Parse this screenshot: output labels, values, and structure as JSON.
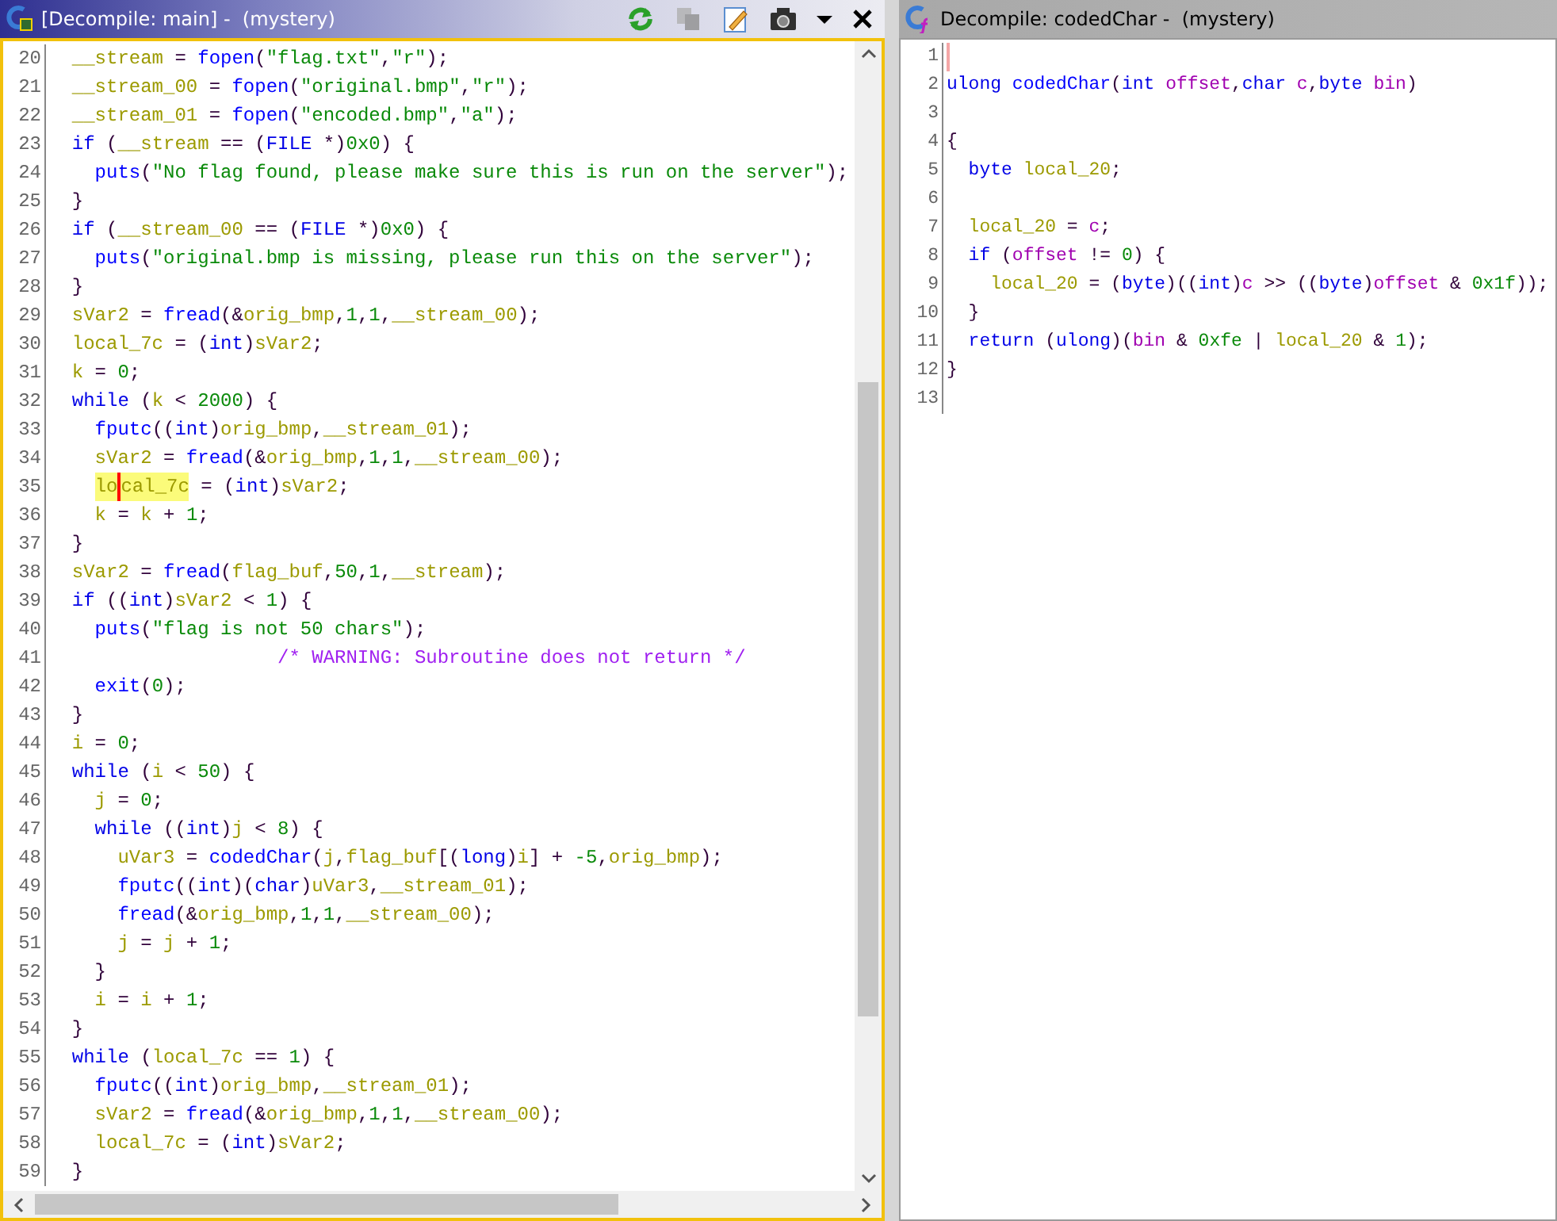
{
  "panes": [
    {
      "title": "[Decompile: main] -  (mystery)",
      "active": true,
      "toolbar": [
        {
          "kind": "refresh",
          "disabled": false
        },
        {
          "kind": "copy",
          "disabled": true
        },
        {
          "kind": "edit",
          "disabled": false
        },
        {
          "kind": "snapshot",
          "disabled": false
        },
        {
          "kind": "menu",
          "disabled": false
        },
        {
          "kind": "close",
          "disabled": false
        }
      ],
      "lines": [
        {
          "number": "20",
          "tokens": [
            {
              "text": "  __stream",
              "kind": "variable"
            },
            {
              "text": " = ",
              "kind": "punct"
            },
            {
              "text": "fopen",
              "kind": "function"
            },
            {
              "text": "(",
              "kind": "punct"
            },
            {
              "text": "\"flag.txt\"",
              "kind": "string"
            },
            {
              "text": ",",
              "kind": "punct"
            },
            {
              "text": "\"r\"",
              "kind": "string"
            },
            {
              "text": ");",
              "kind": "punct"
            }
          ]
        },
        {
          "number": "21",
          "tokens": [
            {
              "text": "  __stream_00",
              "kind": "variable"
            },
            {
              "text": " = ",
              "kind": "punct"
            },
            {
              "text": "fopen",
              "kind": "function"
            },
            {
              "text": "(",
              "kind": "punct"
            },
            {
              "text": "\"original.bmp\"",
              "kind": "string"
            },
            {
              "text": ",",
              "kind": "punct"
            },
            {
              "text": "\"r\"",
              "kind": "string"
            },
            {
              "text": ");",
              "kind": "punct"
            }
          ]
        },
        {
          "number": "22",
          "tokens": [
            {
              "text": "  __stream_01",
              "kind": "variable"
            },
            {
              "text": " = ",
              "kind": "punct"
            },
            {
              "text": "fopen",
              "kind": "function"
            },
            {
              "text": "(",
              "kind": "punct"
            },
            {
              "text": "\"encoded.bmp\"",
              "kind": "string"
            },
            {
              "text": ",",
              "kind": "punct"
            },
            {
              "text": "\"a\"",
              "kind": "string"
            },
            {
              "text": ");",
              "kind": "punct"
            }
          ]
        },
        {
          "number": "23",
          "tokens": [
            {
              "text": "  if",
              "kind": "keyword"
            },
            {
              "text": " (",
              "kind": "punct"
            },
            {
              "text": "__stream",
              "kind": "variable"
            },
            {
              "text": " == (",
              "kind": "punct"
            },
            {
              "text": "FILE",
              "kind": "keyword"
            },
            {
              "text": " *)",
              "kind": "punct"
            },
            {
              "text": "0x0",
              "kind": "string"
            },
            {
              "text": ") {",
              "kind": "punct"
            }
          ]
        },
        {
          "number": "24",
          "tokens": [
            {
              "text": "    puts",
              "kind": "function"
            },
            {
              "text": "(",
              "kind": "punct"
            },
            {
              "text": "\"No flag found, please make sure this is run on the server\"",
              "kind": "string"
            },
            {
              "text": ");",
              "kind": "punct"
            }
          ]
        },
        {
          "number": "25",
          "tokens": [
            {
              "text": "  }",
              "kind": "punct"
            }
          ]
        },
        {
          "number": "26",
          "tokens": [
            {
              "text": "  if",
              "kind": "keyword"
            },
            {
              "text": " (",
              "kind": "punct"
            },
            {
              "text": "__stream_00",
              "kind": "variable"
            },
            {
              "text": " == (",
              "kind": "punct"
            },
            {
              "text": "FILE",
              "kind": "keyword"
            },
            {
              "text": " *)",
              "kind": "punct"
            },
            {
              "text": "0x0",
              "kind": "string"
            },
            {
              "text": ") {",
              "kind": "punct"
            }
          ]
        },
        {
          "number": "27",
          "tokens": [
            {
              "text": "    puts",
              "kind": "function"
            },
            {
              "text": "(",
              "kind": "punct"
            },
            {
              "text": "\"original.bmp is missing, please run this on the server\"",
              "kind": "string"
            },
            {
              "text": ");",
              "kind": "punct"
            }
          ]
        },
        {
          "number": "28",
          "tokens": [
            {
              "text": "  }",
              "kind": "punct"
            }
          ]
        },
        {
          "number": "29",
          "tokens": [
            {
              "text": "  sVar2",
              "kind": "variable"
            },
            {
              "text": " = ",
              "kind": "punct"
            },
            {
              "text": "fread",
              "kind": "function"
            },
            {
              "text": "(&",
              "kind": "punct"
            },
            {
              "text": "orig_bmp",
              "kind": "variable"
            },
            {
              "text": ",",
              "kind": "punct"
            },
            {
              "text": "1",
              "kind": "string"
            },
            {
              "text": ",",
              "kind": "punct"
            },
            {
              "text": "1",
              "kind": "string"
            },
            {
              "text": ",",
              "kind": "punct"
            },
            {
              "text": "__stream_00",
              "kind": "variable"
            },
            {
              "text": ");",
              "kind": "punct"
            }
          ]
        },
        {
          "number": "30",
          "tokens": [
            {
              "text": "  local_7c",
              "kind": "variable"
            },
            {
              "text": " = (",
              "kind": "punct"
            },
            {
              "text": "int",
              "kind": "keyword"
            },
            {
              "text": ")",
              "kind": "punct"
            },
            {
              "text": "sVar2",
              "kind": "variable"
            },
            {
              "text": ";",
              "kind": "punct"
            }
          ]
        },
        {
          "number": "31",
          "tokens": [
            {
              "text": "  k",
              "kind": "variable"
            },
            {
              "text": " = ",
              "kind": "punct"
            },
            {
              "text": "0",
              "kind": "string"
            },
            {
              "text": ";",
              "kind": "punct"
            }
          ]
        },
        {
          "number": "32",
          "tokens": [
            {
              "text": "  while",
              "kind": "keyword"
            },
            {
              "text": " (",
              "kind": "punct"
            },
            {
              "text": "k",
              "kind": "variable"
            },
            {
              "text": " < ",
              "kind": "punct"
            },
            {
              "text": "2000",
              "kind": "string"
            },
            {
              "text": ") {",
              "kind": "punct"
            }
          ]
        },
        {
          "number": "33",
          "tokens": [
            {
              "text": "    fputc",
              "kind": "function"
            },
            {
              "text": "((",
              "kind": "punct"
            },
            {
              "text": "int",
              "kind": "keyword"
            },
            {
              "text": ")",
              "kind": "punct"
            },
            {
              "text": "orig_bmp",
              "kind": "variable"
            },
            {
              "text": ",",
              "kind": "punct"
            },
            {
              "text": "__stream_01",
              "kind": "variable"
            },
            {
              "text": ");",
              "kind": "punct"
            }
          ]
        },
        {
          "number": "34",
          "tokens": [
            {
              "text": "    sVar2",
              "kind": "variable"
            },
            {
              "text": " = ",
              "kind": "punct"
            },
            {
              "text": "fread",
              "kind": "function"
            },
            {
              "text": "(&",
              "kind": "punct"
            },
            {
              "text": "orig_bmp",
              "kind": "variable"
            },
            {
              "text": ",",
              "kind": "punct"
            },
            {
              "text": "1",
              "kind": "string"
            },
            {
              "text": ",",
              "kind": "punct"
            },
            {
              "text": "1",
              "kind": "string"
            },
            {
              "text": ",",
              "kind": "punct"
            },
            {
              "text": "__stream_00",
              "kind": "variable"
            },
            {
              "text": ");",
              "kind": "punct"
            }
          ]
        },
        {
          "number": "35",
          "tokens": [
            {
              "text": "    lo",
              "kind": "match"
            },
            {
              "kind": "caret"
            },
            {
              "text": "cal_7c",
              "kind": "match"
            },
            {
              "text": " = (",
              "kind": "punct"
            },
            {
              "text": "int",
              "kind": "keyword"
            },
            {
              "text": ")",
              "kind": "punct"
            },
            {
              "text": "sVar2",
              "kind": "variable"
            },
            {
              "text": ";",
              "kind": "punct"
            }
          ]
        },
        {
          "number": "36",
          "tokens": [
            {
              "text": "    k",
              "kind": "variable"
            },
            {
              "text": " = ",
              "kind": "punct"
            },
            {
              "text": "k",
              "kind": "variable"
            },
            {
              "text": " + ",
              "kind": "punct"
            },
            {
              "text": "1",
              "kind": "string"
            },
            {
              "text": ";",
              "kind": "punct"
            }
          ]
        },
        {
          "number": "37",
          "tokens": [
            {
              "text": "  }",
              "kind": "punct"
            }
          ]
        },
        {
          "number": "38",
          "tokens": [
            {
              "text": "  sVar2",
              "kind": "variable"
            },
            {
              "text": " = ",
              "kind": "punct"
            },
            {
              "text": "fread",
              "kind": "function"
            },
            {
              "text": "(",
              "kind": "punct"
            },
            {
              "text": "flag_buf",
              "kind": "variable"
            },
            {
              "text": ",",
              "kind": "punct"
            },
            {
              "text": "50",
              "kind": "string"
            },
            {
              "text": ",",
              "kind": "punct"
            },
            {
              "text": "1",
              "kind": "string"
            },
            {
              "text": ",",
              "kind": "punct"
            },
            {
              "text": "__stream",
              "kind": "variable"
            },
            {
              "text": ");",
              "kind": "punct"
            }
          ]
        },
        {
          "number": "39",
          "tokens": [
            {
              "text": "  if",
              "kind": "keyword"
            },
            {
              "text": " ((",
              "kind": "punct"
            },
            {
              "text": "int",
              "kind": "keyword"
            },
            {
              "text": ")",
              "kind": "punct"
            },
            {
              "text": "sVar2",
              "kind": "variable"
            },
            {
              "text": " < ",
              "kind": "punct"
            },
            {
              "text": "1",
              "kind": "string"
            },
            {
              "text": ") {",
              "kind": "punct"
            }
          ]
        },
        {
          "number": "40",
          "tokens": [
            {
              "text": "    puts",
              "kind": "function"
            },
            {
              "text": "(",
              "kind": "punct"
            },
            {
              "text": "\"flag is not 50 chars\"",
              "kind": "string"
            },
            {
              "text": ");",
              "kind": "punct"
            }
          ]
        },
        {
          "number": "41",
          "tokens": [
            {
              "text": "                    /* WARNING: Subroutine does not return */",
              "kind": "comment"
            }
          ]
        },
        {
          "number": "42",
          "tokens": [
            {
              "text": "    exit",
              "kind": "function"
            },
            {
              "text": "(",
              "kind": "punct"
            },
            {
              "text": "0",
              "kind": "string"
            },
            {
              "text": ");",
              "kind": "punct"
            }
          ]
        },
        {
          "number": "43",
          "tokens": [
            {
              "text": "  }",
              "kind": "punct"
            }
          ]
        },
        {
          "number": "44",
          "tokens": [
            {
              "text": "  i",
              "kind": "variable"
            },
            {
              "text": " = ",
              "kind": "punct"
            },
            {
              "text": "0",
              "kind": "string"
            },
            {
              "text": ";",
              "kind": "punct"
            }
          ]
        },
        {
          "number": "45",
          "tokens": [
            {
              "text": "  while",
              "kind": "keyword"
            },
            {
              "text": " (",
              "kind": "punct"
            },
            {
              "text": "i",
              "kind": "variable"
            },
            {
              "text": " < ",
              "kind": "punct"
            },
            {
              "text": "50",
              "kind": "string"
            },
            {
              "text": ") {",
              "kind": "punct"
            }
          ]
        },
        {
          "number": "46",
          "tokens": [
            {
              "text": "    j",
              "kind": "variable"
            },
            {
              "text": " = ",
              "kind": "punct"
            },
            {
              "text": "0",
              "kind": "string"
            },
            {
              "text": ";",
              "kind": "punct"
            }
          ]
        },
        {
          "number": "47",
          "tokens": [
            {
              "text": "    while",
              "kind": "keyword"
            },
            {
              "text": " ((",
              "kind": "punct"
            },
            {
              "text": "int",
              "kind": "keyword"
            },
            {
              "text": ")",
              "kind": "punct"
            },
            {
              "text": "j",
              "kind": "variable"
            },
            {
              "text": " < ",
              "kind": "punct"
            },
            {
              "text": "8",
              "kind": "string"
            },
            {
              "text": ") {",
              "kind": "punct"
            }
          ]
        },
        {
          "number": "48",
          "tokens": [
            {
              "text": "      uVar3",
              "kind": "variable"
            },
            {
              "text": " = ",
              "kind": "punct"
            },
            {
              "text": "codedChar",
              "kind": "function"
            },
            {
              "text": "(",
              "kind": "punct"
            },
            {
              "text": "j",
              "kind": "variable"
            },
            {
              "text": ",",
              "kind": "punct"
            },
            {
              "text": "flag_buf",
              "kind": "variable"
            },
            {
              "text": "[(",
              "kind": "punct"
            },
            {
              "text": "long",
              "kind": "keyword"
            },
            {
              "text": ")",
              "kind": "punct"
            },
            {
              "text": "i",
              "kind": "variable"
            },
            {
              "text": "] + ",
              "kind": "punct"
            },
            {
              "text": "-5",
              "kind": "string"
            },
            {
              "text": ",",
              "kind": "punct"
            },
            {
              "text": "orig_bmp",
              "kind": "variable"
            },
            {
              "text": ");",
              "kind": "punct"
            }
          ]
        },
        {
          "number": "49",
          "tokens": [
            {
              "text": "      fputc",
              "kind": "function"
            },
            {
              "text": "((",
              "kind": "punct"
            },
            {
              "text": "int",
              "kind": "keyword"
            },
            {
              "text": ")(",
              "kind": "punct"
            },
            {
              "text": "char",
              "kind": "keyword"
            },
            {
              "text": ")",
              "kind": "punct"
            },
            {
              "text": "uVar3",
              "kind": "variable"
            },
            {
              "text": ",",
              "kind": "punct"
            },
            {
              "text": "__stream_01",
              "kind": "variable"
            },
            {
              "text": ");",
              "kind": "punct"
            }
          ]
        },
        {
          "number": "50",
          "tokens": [
            {
              "text": "      fread",
              "kind": "function"
            },
            {
              "text": "(&",
              "kind": "punct"
            },
            {
              "text": "orig_bmp",
              "kind": "variable"
            },
            {
              "text": ",",
              "kind": "punct"
            },
            {
              "text": "1",
              "kind": "string"
            },
            {
              "text": ",",
              "kind": "punct"
            },
            {
              "text": "1",
              "kind": "string"
            },
            {
              "text": ",",
              "kind": "punct"
            },
            {
              "text": "__stream_00",
              "kind": "variable"
            },
            {
              "text": ");",
              "kind": "punct"
            }
          ]
        },
        {
          "number": "51",
          "tokens": [
            {
              "text": "      j",
              "kind": "variable"
            },
            {
              "text": " = ",
              "kind": "punct"
            },
            {
              "text": "j",
              "kind": "variable"
            },
            {
              "text": " + ",
              "kind": "punct"
            },
            {
              "text": "1",
              "kind": "string"
            },
            {
              "text": ";",
              "kind": "punct"
            }
          ]
        },
        {
          "number": "52",
          "tokens": [
            {
              "text": "    }",
              "kind": "punct"
            }
          ]
        },
        {
          "number": "53",
          "tokens": [
            {
              "text": "    i",
              "kind": "variable"
            },
            {
              "text": " = ",
              "kind": "punct"
            },
            {
              "text": "i",
              "kind": "variable"
            },
            {
              "text": " + ",
              "kind": "punct"
            },
            {
              "text": "1",
              "kind": "string"
            },
            {
              "text": ";",
              "kind": "punct"
            }
          ]
        },
        {
          "number": "54",
          "tokens": [
            {
              "text": "  }",
              "kind": "punct"
            }
          ]
        },
        {
          "number": "55",
          "tokens": [
            {
              "text": "  while",
              "kind": "keyword"
            },
            {
              "text": " (",
              "kind": "punct"
            },
            {
              "text": "local_7c",
              "kind": "variable"
            },
            {
              "text": " == ",
              "kind": "punct"
            },
            {
              "text": "1",
              "kind": "string"
            },
            {
              "text": ") {",
              "kind": "punct"
            }
          ]
        },
        {
          "number": "56",
          "tokens": [
            {
              "text": "    fputc",
              "kind": "function"
            },
            {
              "text": "((",
              "kind": "punct"
            },
            {
              "text": "int",
              "kind": "keyword"
            },
            {
              "text": ")",
              "kind": "punct"
            },
            {
              "text": "orig_bmp",
              "kind": "variable"
            },
            {
              "text": ",",
              "kind": "punct"
            },
            {
              "text": "__stream_01",
              "kind": "variable"
            },
            {
              "text": ");",
              "kind": "punct"
            }
          ]
        },
        {
          "number": "57",
          "tokens": [
            {
              "text": "    sVar2",
              "kind": "variable"
            },
            {
              "text": " = ",
              "kind": "punct"
            },
            {
              "text": "fread",
              "kind": "function"
            },
            {
              "text": "(&",
              "kind": "punct"
            },
            {
              "text": "orig_bmp",
              "kind": "variable"
            },
            {
              "text": ",",
              "kind": "punct"
            },
            {
              "text": "1",
              "kind": "string"
            },
            {
              "text": ",",
              "kind": "punct"
            },
            {
              "text": "1",
              "kind": "string"
            },
            {
              "text": ",",
              "kind": "punct"
            },
            {
              "text": "__stream_00",
              "kind": "variable"
            },
            {
              "text": ");",
              "kind": "punct"
            }
          ]
        },
        {
          "number": "58",
          "tokens": [
            {
              "text": "    local_7c",
              "kind": "variable"
            },
            {
              "text": " = (",
              "kind": "punct"
            },
            {
              "text": "int",
              "kind": "keyword"
            },
            {
              "text": ")",
              "kind": "punct"
            },
            {
              "text": "sVar2",
              "kind": "variable"
            },
            {
              "text": ";",
              "kind": "punct"
            }
          ]
        },
        {
          "number": "59",
          "tokens": [
            {
              "text": "  }",
              "kind": "punct"
            }
          ]
        }
      ]
    },
    {
      "title": "Decompile: codedChar -  (mystery)",
      "active": false,
      "lines": [
        {
          "number": "1",
          "tokens": [
            {
              "kind": "caret"
            }
          ]
        },
        {
          "number": "2",
          "tokens": [
            {
              "text": "ulong ",
              "kind": "keyword"
            },
            {
              "text": "codedChar",
              "kind": "function"
            },
            {
              "text": "(",
              "kind": "punct"
            },
            {
              "text": "int ",
              "kind": "keyword"
            },
            {
              "text": "offset",
              "kind": "param"
            },
            {
              "text": ",",
              "kind": "punct"
            },
            {
              "text": "char ",
              "kind": "keyword"
            },
            {
              "text": "c",
              "kind": "param"
            },
            {
              "text": ",",
              "kind": "punct"
            },
            {
              "text": "byte ",
              "kind": "keyword"
            },
            {
              "text": "bin",
              "kind": "param"
            },
            {
              "text": ")",
              "kind": "punct"
            }
          ]
        },
        {
          "number": "3"
        },
        {
          "number": "4",
          "tokens": [
            {
              "text": "{",
              "kind": "punct"
            }
          ]
        },
        {
          "number": "5",
          "tokens": [
            {
              "text": "  byte ",
              "kind": "keyword"
            },
            {
              "text": "local_20",
              "kind": "variable"
            },
            {
              "text": ";",
              "kind": "punct"
            }
          ]
        },
        {
          "number": "6"
        },
        {
          "number": "7",
          "tokens": [
            {
              "text": "  local_20",
              "kind": "variable"
            },
            {
              "text": " = ",
              "kind": "punct"
            },
            {
              "text": "c",
              "kind": "param"
            },
            {
              "text": ";",
              "kind": "punct"
            }
          ]
        },
        {
          "number": "8",
          "tokens": [
            {
              "text": "  if",
              "kind": "keyword"
            },
            {
              "text": " (",
              "kind": "punct"
            },
            {
              "text": "offset",
              "kind": "param"
            },
            {
              "text": " != ",
              "kind": "punct"
            },
            {
              "text": "0",
              "kind": "string"
            },
            {
              "text": ") {",
              "kind": "punct"
            }
          ]
        },
        {
          "number": "9",
          "tokens": [
            {
              "text": "    local_20",
              "kind": "variable"
            },
            {
              "text": " = (",
              "kind": "punct"
            },
            {
              "text": "byte",
              "kind": "keyword"
            },
            {
              "text": ")((",
              "kind": "punct"
            },
            {
              "text": "int",
              "kind": "keyword"
            },
            {
              "text": ")",
              "kind": "punct"
            },
            {
              "text": "c",
              "kind": "param"
            },
            {
              "text": " >> ((",
              "kind": "punct"
            },
            {
              "text": "byte",
              "kind": "keyword"
            },
            {
              "text": ")",
              "kind": "punct"
            },
            {
              "text": "offset",
              "kind": "param"
            },
            {
              "text": " & ",
              "kind": "punct"
            },
            {
              "text": "0x1f",
              "kind": "string"
            },
            {
              "text": "));",
              "kind": "punct"
            }
          ]
        },
        {
          "number": "10",
          "tokens": [
            {
              "text": "  }",
              "kind": "punct"
            }
          ]
        },
        {
          "number": "11",
          "tokens": [
            {
              "text": "  return",
              "kind": "keyword"
            },
            {
              "text": " (",
              "kind": "punct"
            },
            {
              "text": "ulong",
              "kind": "keyword"
            },
            {
              "text": ")(",
              "kind": "punct"
            },
            {
              "text": "bin",
              "kind": "param"
            },
            {
              "text": " & ",
              "kind": "punct"
            },
            {
              "text": "0xfe",
              "kind": "string"
            },
            {
              "text": " | ",
              "kind": "punct"
            },
            {
              "text": "local_20",
              "kind": "variable"
            },
            {
              "text": " & ",
              "kind": "punct"
            },
            {
              "text": "1",
              "kind": "string"
            },
            {
              "text": ");",
              "kind": "punct"
            }
          ]
        },
        {
          "number": "12",
          "tokens": [
            {
              "text": "}",
              "kind": "punct"
            }
          ]
        },
        {
          "number": "13"
        }
      ]
    }
  ]
}
